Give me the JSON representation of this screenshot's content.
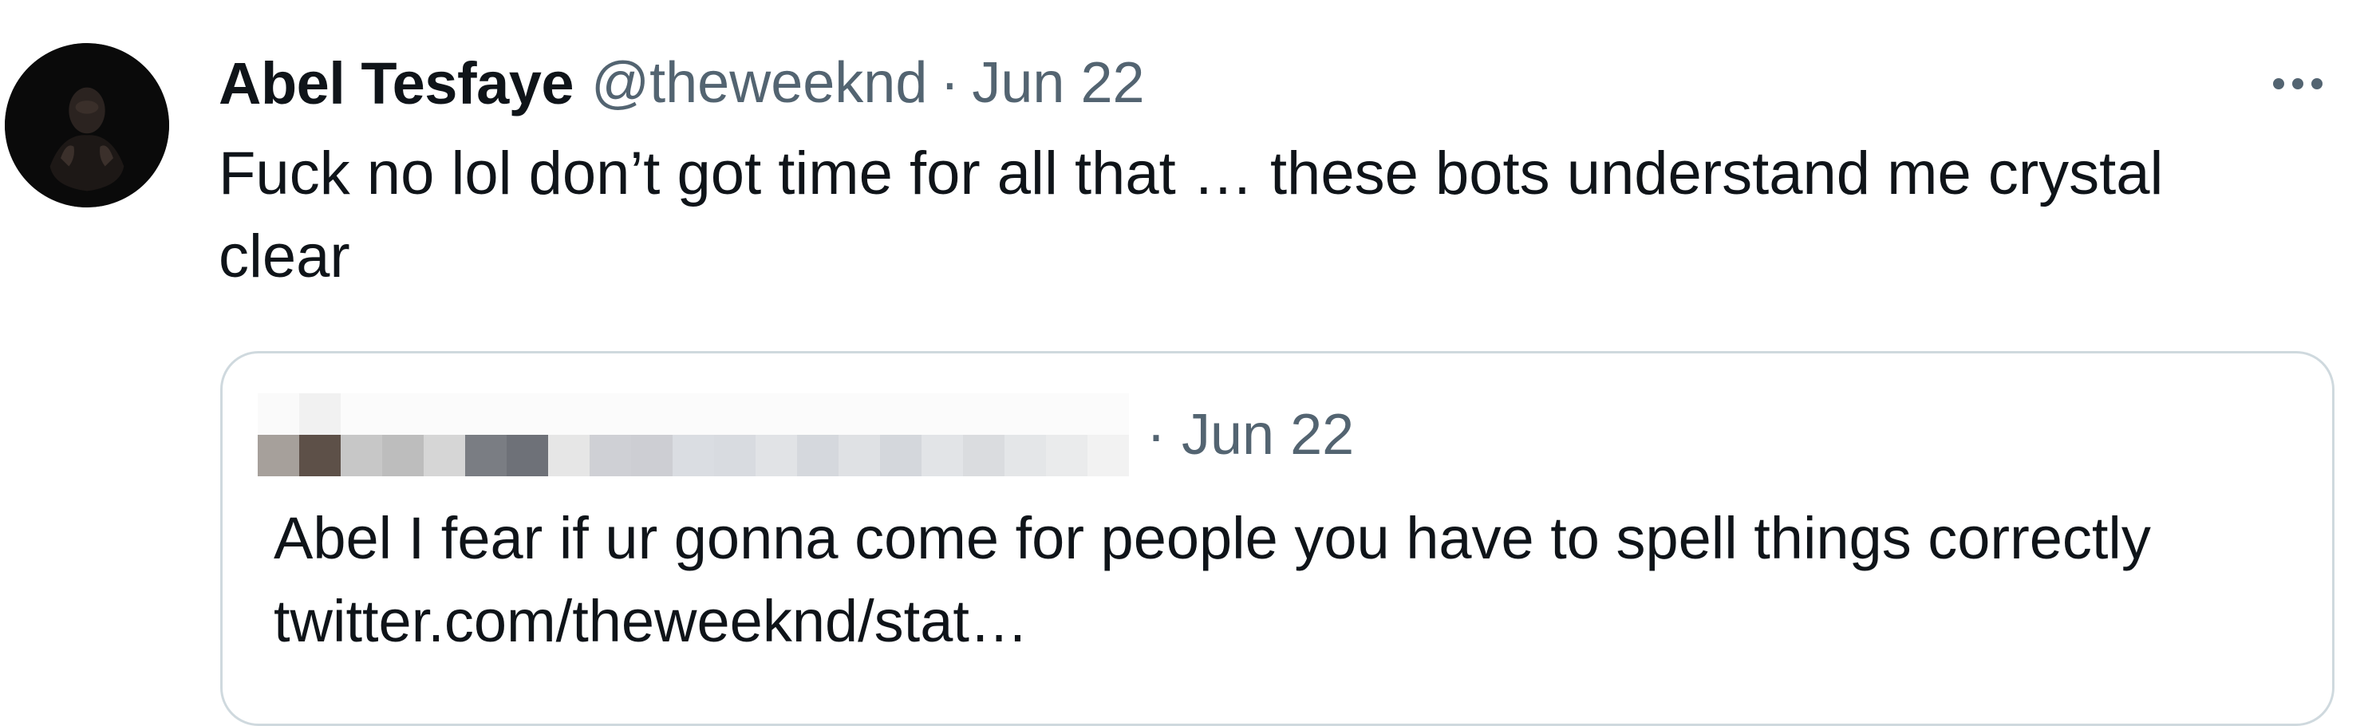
{
  "tweet": {
    "display_name": "Abel Tesfaye",
    "handle": "@theweeknd",
    "separator": "·",
    "date": "Jun 22",
    "text": "Fuck no lol don’t got time for all that … these bots understand me crystal clear",
    "more_icon": "more-horizontal-icon"
  },
  "quoted_tweet": {
    "author": "",
    "separator": "·",
    "date": "Jun 22",
    "text": "Abel I fear if ur gonna come for people you have to spell things correctly ",
    "link": "twitter.com/theweeknd/stat…"
  },
  "colors": {
    "primary_text": "#0f1419",
    "secondary_text": "#536471",
    "card_border": "#cfd9de"
  }
}
